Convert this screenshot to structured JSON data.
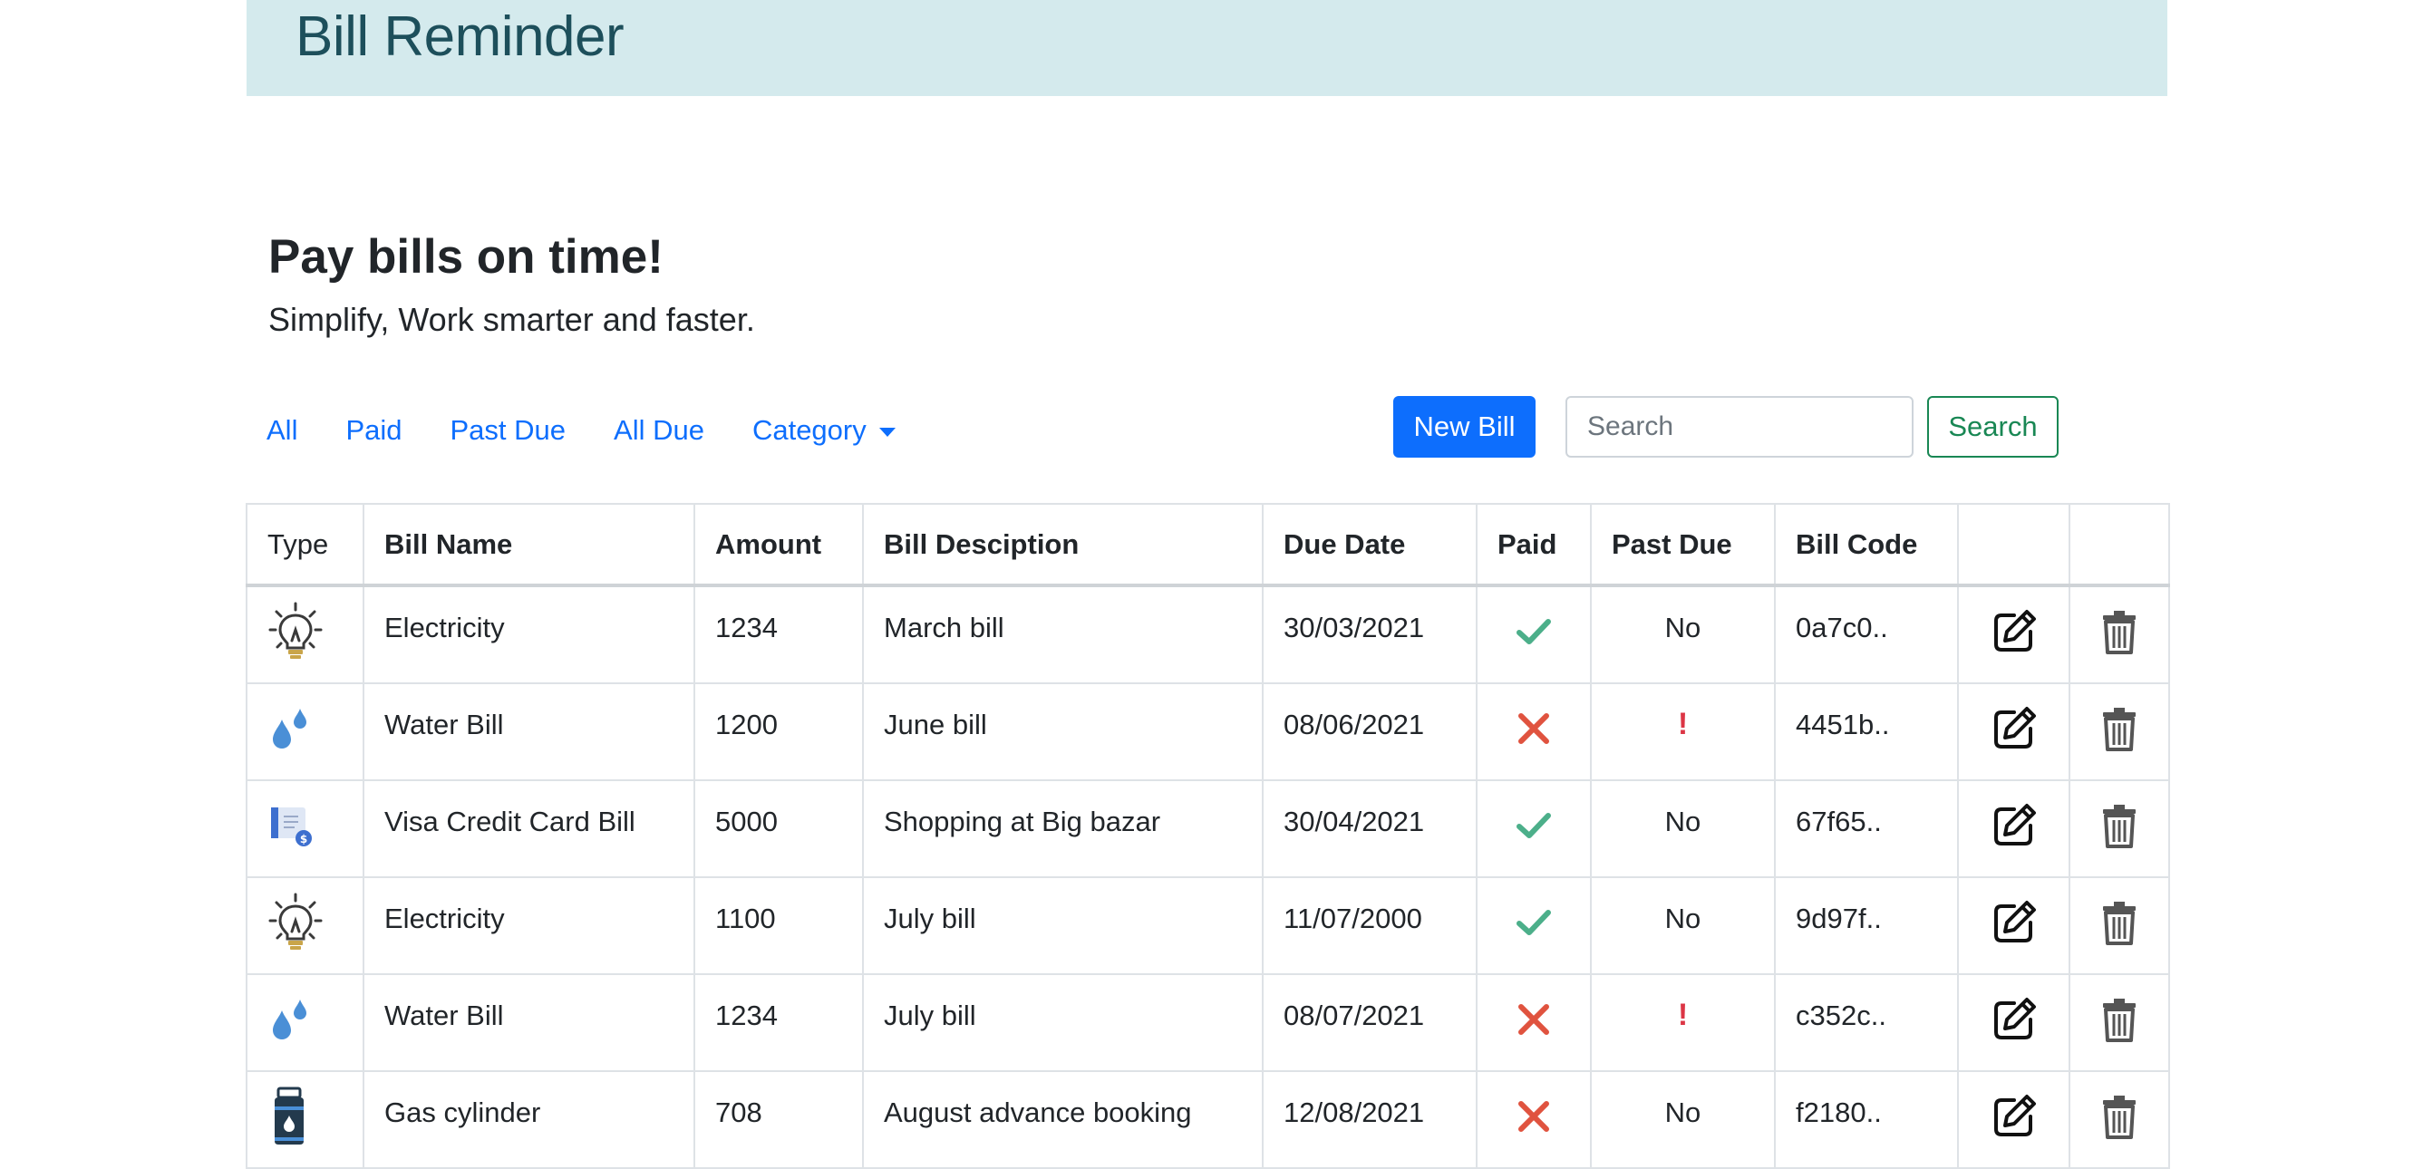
{
  "app": {
    "title": "Bill Reminder"
  },
  "hero": {
    "title": "Pay bills on time!",
    "subtitle": "Simplify, Work smarter and faster."
  },
  "nav": {
    "all": "All",
    "paid": "Paid",
    "past_due": "Past Due",
    "all_due": "All Due",
    "category": "Category"
  },
  "toolbar": {
    "new_bill": "New Bill",
    "search_placeholder": "Search",
    "search_button": "Search"
  },
  "table": {
    "headers": {
      "type": "Type",
      "bill_name": "Bill Name",
      "amount": "Amount",
      "description": "Bill Desciption",
      "due_date": "Due Date",
      "paid": "Paid",
      "past_due": "Past Due",
      "bill_code": "Bill Code"
    },
    "rows": [
      {
        "type_icon": "lightbulb-icon",
        "name": "Electricity",
        "amount": "1234",
        "description": "March bill",
        "due_date": "30/03/2021",
        "paid": true,
        "past_due": "No",
        "code": "0a7c0.."
      },
      {
        "type_icon": "water-drops-icon",
        "name": "Water Bill",
        "amount": "1200",
        "description": "June bill",
        "due_date": "08/06/2021",
        "paid": false,
        "past_due": "!",
        "code": "4451b.."
      },
      {
        "type_icon": "credit-card-bill-icon",
        "name": "Visa Credit Card Bill",
        "amount": "5000",
        "description": "Shopping at Big bazar",
        "due_date": "30/04/2021",
        "paid": true,
        "past_due": "No",
        "code": "67f65.."
      },
      {
        "type_icon": "lightbulb-icon",
        "name": "Electricity",
        "amount": "1100",
        "description": "July bill",
        "due_date": "11/07/2000",
        "paid": true,
        "past_due": "No",
        "code": "9d97f.."
      },
      {
        "type_icon": "water-drops-icon",
        "name": "Water Bill",
        "amount": "1234",
        "description": "July bill",
        "due_date": "08/07/2021",
        "paid": false,
        "past_due": "!",
        "code": "c352c.."
      },
      {
        "type_icon": "gas-cylinder-icon",
        "name": "Gas cylinder",
        "amount": "708",
        "description": "August advance booking",
        "due_date": "12/08/2021",
        "paid": false,
        "past_due": "No",
        "code": "f2180.."
      }
    ]
  },
  "colors": {
    "header_band": "#d4eaed",
    "title": "#1d4f5b",
    "primary": "#0d6efd",
    "success": "#198754",
    "check": "#4caf8a",
    "cross": "#e0533f",
    "alert": "#dc3545"
  }
}
